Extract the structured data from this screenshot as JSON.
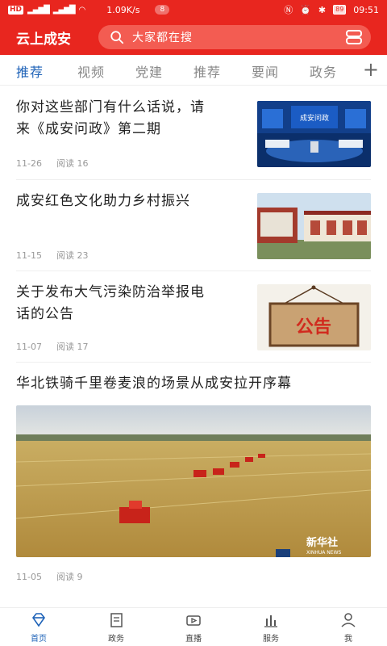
{
  "status_bar": {
    "hd": "HD",
    "net_speed": "1.09K/s",
    "notif_count": "8",
    "battery": "89",
    "time": "09:51"
  },
  "header": {
    "title": "云上成安",
    "search_placeholder": "大家都在搜"
  },
  "tabs": [
    "推荐",
    "视频",
    "党建",
    "推荐",
    "要闻",
    "政务"
  ],
  "add_tab": "+",
  "articles": [
    {
      "title_line1": "你对这些部门有什么话说，请",
      "title_line2": "来《成安问政》第二期",
      "date": "11-26",
      "reads": "阅读 16",
      "thumb_caption": "成安问政"
    },
    {
      "title_line1": "成安红色文化助力乡村振兴",
      "date": "11-15",
      "reads": "阅读 23"
    },
    {
      "title_line1": "关于发布大气污染防治举报电",
      "title_line2": "话的公告",
      "date": "11-07",
      "reads": "阅读 17",
      "thumb_caption": "公告"
    },
    {
      "title_line1": "华北铁骑千里卷麦浪的场景从成安拉开序幕",
      "date": "11-05",
      "reads": "阅读 9",
      "watermark": "新华社",
      "watermark_en": "XINHUA NEWS"
    }
  ],
  "bottom_nav": [
    {
      "label": "首页",
      "icon": "diamond-icon"
    },
    {
      "label": "政务",
      "icon": "document-icon"
    },
    {
      "label": "直播",
      "icon": "video-icon"
    },
    {
      "label": "服务",
      "icon": "chart-bars-icon"
    },
    {
      "label": "我",
      "icon": "person-icon"
    }
  ],
  "colors": {
    "brand_red": "#e8261f",
    "active_blue": "#1f63b8"
  }
}
